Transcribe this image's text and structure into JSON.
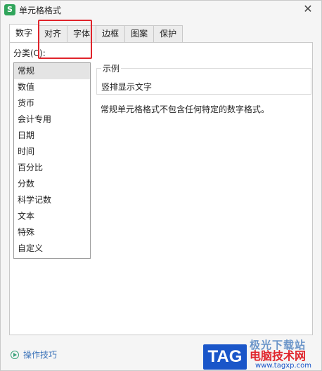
{
  "window": {
    "icon_glyph": "S",
    "title": "单元格格式",
    "close_glyph": "✕"
  },
  "tabs": [
    {
      "label": "数字",
      "active": true
    },
    {
      "label": "对齐",
      "active": false
    },
    {
      "label": "字体",
      "active": false
    },
    {
      "label": "边框",
      "active": false
    },
    {
      "label": "图案",
      "active": false
    },
    {
      "label": "保护",
      "active": false
    }
  ],
  "category": {
    "label": "分类(C):",
    "items": [
      "常规",
      "数值",
      "货币",
      "会计专用",
      "日期",
      "时间",
      "百分比",
      "分数",
      "科学记数",
      "文本",
      "特殊",
      "自定义"
    ],
    "selected": "常规"
  },
  "sample": {
    "title": "示例",
    "value": "竖排显示文字"
  },
  "description": "常规单元格格式不包含任何特定的数字格式。",
  "footer": {
    "tips_label": "操作技巧"
  },
  "watermark": {
    "tag": "TAG",
    "top_text": "极光下载站",
    "cn_text": "电脑技术网",
    "url": "www.tagxp.com"
  },
  "colors": {
    "highlight": "#e0242b",
    "app_icon": "#30a55b",
    "link": "#3b73b9"
  }
}
